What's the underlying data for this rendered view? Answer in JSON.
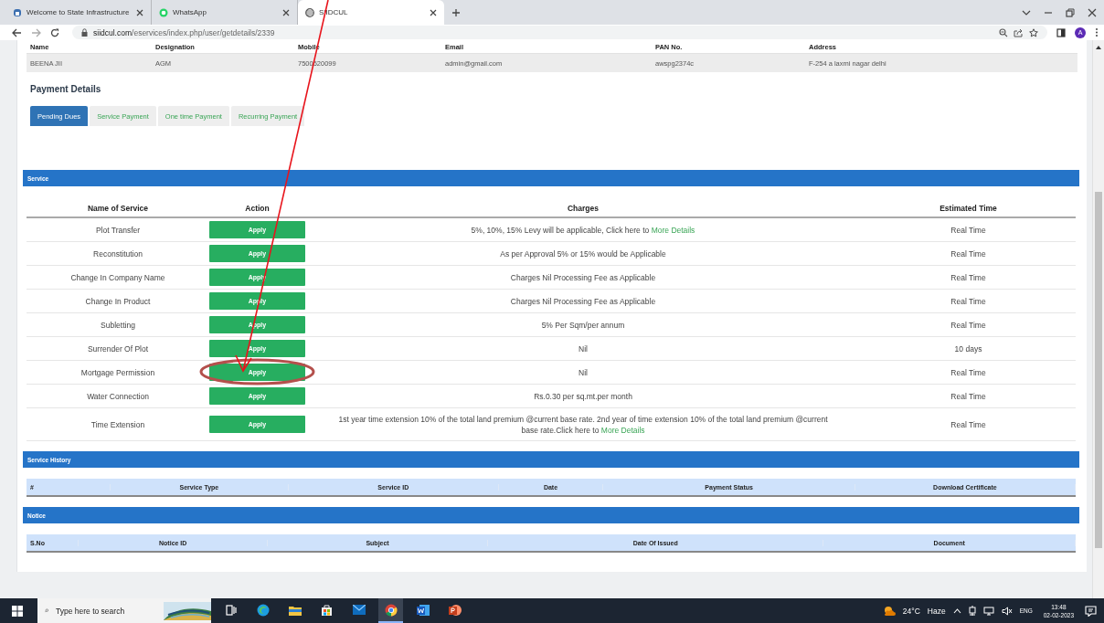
{
  "browser": {
    "tabs": [
      {
        "title": "Welcome to State Infrastructure",
        "kind": "site",
        "selected": false
      },
      {
        "title": "WhatsApp",
        "kind": "whatsapp",
        "selected": false
      },
      {
        "title": "SIIDCUL",
        "kind": "globe",
        "selected": true
      }
    ],
    "url_host": "siidcul.com",
    "url_path": "/eservices/index.php/user/getdetails/2339",
    "profile_initial": "A"
  },
  "profile": {
    "columns": [
      "Name",
      "Designation",
      "Mobile",
      "Email",
      "PAN No.",
      "Address"
    ],
    "row": [
      "BEENA JII",
      "AGM",
      "7500520099",
      "admin@gmail.com",
      "awspg2374c",
      "F-254 a laxmi nagar delhi"
    ]
  },
  "payment": {
    "title": "Payment Details",
    "tabs": [
      {
        "label": "Pending Dues",
        "selected": true
      },
      {
        "label": "Service Payment",
        "selected": false
      },
      {
        "label": "One time Payment",
        "selected": false
      },
      {
        "label": "Recurring Payment",
        "selected": false
      }
    ]
  },
  "service": {
    "title": "Service",
    "columns": [
      "Name of Service",
      "Action",
      "Charges",
      "Estimated Time"
    ],
    "rows": [
      {
        "name": "Plot Transfer",
        "action": "Apply",
        "charges": "5%, 10%, 15% Levy will be applicable, Click here to",
        "link": "More Details",
        "time": "Real Time",
        "circled": false
      },
      {
        "name": "Reconstitution",
        "action": "Apply",
        "charges": "As per Approval 5% or 15% would be Applicable",
        "time": "Real Time",
        "circled": false
      },
      {
        "name": "Change In Company Name",
        "action": "Apply",
        "charges": "Charges Nil Processing Fee as Applicable",
        "time": "Real Time",
        "circled": false
      },
      {
        "name": "Change In Product",
        "action": "Apply",
        "charges": "Charges Nil Processing Fee as Applicable",
        "time": "Real Time",
        "circled": false
      },
      {
        "name": "Subletting",
        "action": "Apply",
        "charges": "5% Per Sqm/per annum",
        "time": "Real Time",
        "circled": false
      },
      {
        "name": "Surrender Of Plot",
        "action": "Apply",
        "charges": "Nil",
        "time": "10 days",
        "circled": false
      },
      {
        "name": "Mortgage Permission",
        "action": "Apply",
        "charges": "Nil",
        "time": "Real Time",
        "circled": true
      },
      {
        "name": "Water Connection",
        "action": "Apply",
        "charges": "Rs.0.30 per sq.mt.per month",
        "time": "Real Time",
        "circled": false
      },
      {
        "name": "Time Extension",
        "action": "Apply",
        "charges": "1st year time extension 10% of the total land premium @current base rate. 2nd year of time extension 10% of the total land premium @current base rate.Click here to",
        "link": "More Details",
        "time": "Real Time",
        "circled": false
      }
    ]
  },
  "history": {
    "title": "Service History",
    "columns": [
      "#",
      "Service Type",
      "Service ID",
      "Date",
      "Payment Status",
      "Download Certificate"
    ]
  },
  "notice": {
    "title": "Notice",
    "columns": [
      "S.No",
      "Notice ID",
      "Subject",
      "Date Of Issued",
      "Document"
    ]
  },
  "annotation_arrow": true,
  "taskbar": {
    "search_placeholder": "Type here to search",
    "apps": [
      {
        "kind": "taskview",
        "selected": false
      },
      {
        "kind": "edge",
        "selected": false
      },
      {
        "kind": "explorer",
        "selected": false
      },
      {
        "kind": "store",
        "selected": false
      },
      {
        "kind": "mail",
        "selected": false
      },
      {
        "kind": "chrome",
        "selected": true
      },
      {
        "kind": "word",
        "selected": false
      },
      {
        "kind": "powerpoint",
        "selected": false
      }
    ],
    "temperature": "24°C",
    "weather": "Haze",
    "language": "ENG",
    "time": "13:48",
    "date": "02-02-2023"
  }
}
